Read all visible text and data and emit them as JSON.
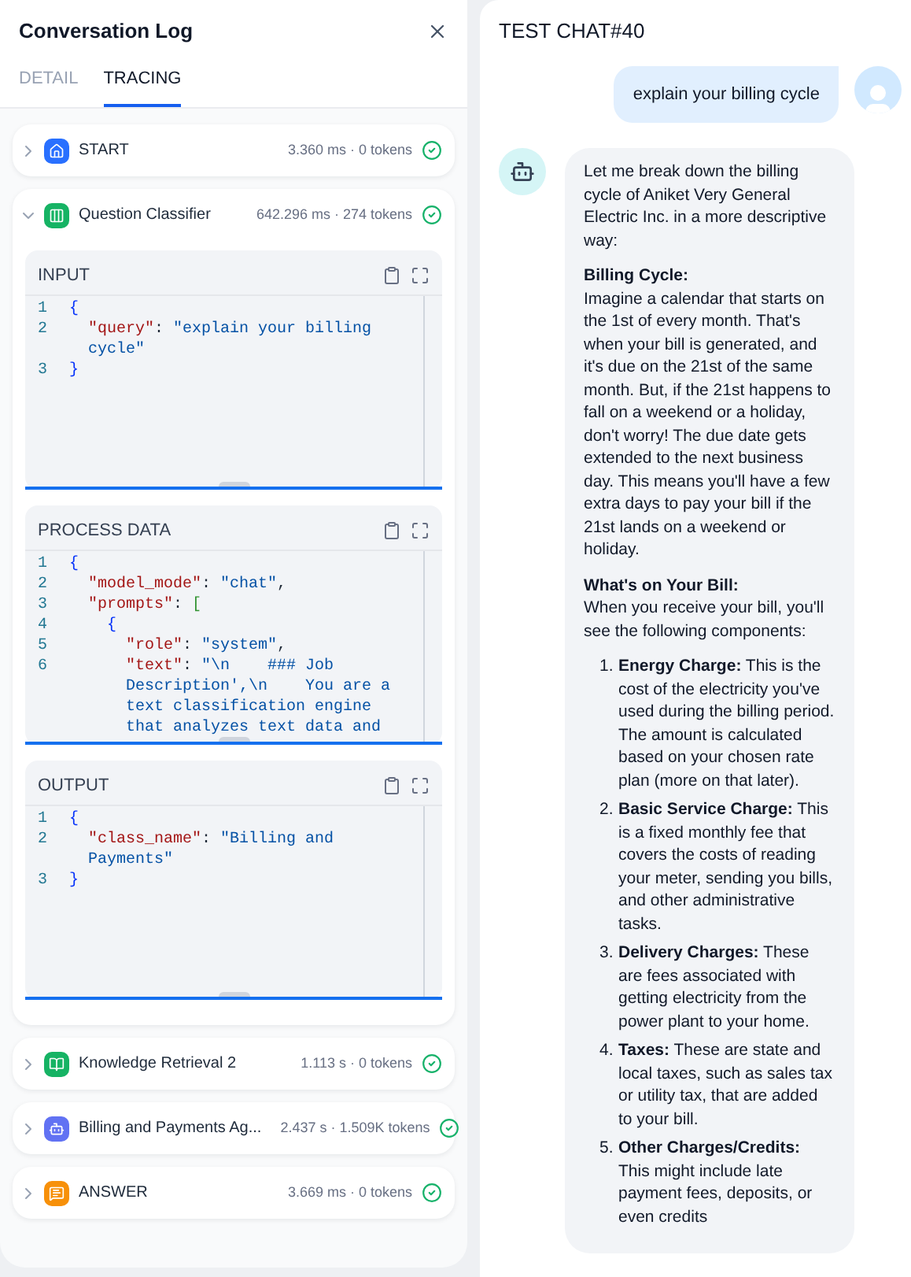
{
  "panel": {
    "title": "Conversation Log",
    "tabs": [
      {
        "label": "DETAIL",
        "selected": false
      },
      {
        "label": "TRACING",
        "selected": true
      }
    ],
    "nodes": [
      {
        "kind": "start",
        "title": "START",
        "color": "#2970ff",
        "stats": "3.360 ms · 0 tokens",
        "expanded": false
      },
      {
        "kind": "question-classifier",
        "title": "Question Classifier",
        "color": "#16b364",
        "stats": "642.296 ms · 274 tokens",
        "expanded": true,
        "sections": [
          {
            "title": "INPUT",
            "lines": [
              {
                "no": "1",
                "parts": [
                  {
                    "kind": "brace",
                    "text": "{"
                  }
                ]
              },
              {
                "no": "2",
                "parts": [
                  {
                    "kind": "key",
                    "text": "  \"query\""
                  },
                  {
                    "kind": "punct",
                    "text": ": "
                  },
                  {
                    "kind": "string",
                    "text": "\"explain your billing"
                  }
                ]
              },
              {
                "parts": [
                  {
                    "kind": "string",
                    "text": "  cycle\""
                  }
                ]
              },
              {
                "no": "3",
                "parts": [
                  {
                    "kind": "brace",
                    "text": "}"
                  }
                ]
              }
            ]
          },
          {
            "title": "PROCESS DATA",
            "lines": [
              {
                "no": "1",
                "parts": [
                  {
                    "kind": "brace",
                    "text": "{"
                  }
                ]
              },
              {
                "no": "2",
                "parts": [
                  {
                    "kind": "key",
                    "text": "  \"model_mode\""
                  },
                  {
                    "kind": "punct",
                    "text": ": "
                  },
                  {
                    "kind": "string",
                    "text": "\"chat\""
                  },
                  {
                    "kind": "punct",
                    "text": ","
                  }
                ]
              },
              {
                "no": "3",
                "parts": [
                  {
                    "kind": "key",
                    "text": "  \"prompts\""
                  },
                  {
                    "kind": "punct",
                    "text": ": "
                  },
                  {
                    "kind": "bracket",
                    "text": "["
                  }
                ]
              },
              {
                "no": "4",
                "parts": [
                  {
                    "kind": "brace",
                    "text": "    {"
                  }
                ]
              },
              {
                "no": "5",
                "parts": [
                  {
                    "kind": "key",
                    "text": "      \"role\""
                  },
                  {
                    "kind": "punct",
                    "text": ": "
                  },
                  {
                    "kind": "string",
                    "text": "\"system\""
                  },
                  {
                    "kind": "punct",
                    "text": ","
                  }
                ]
              },
              {
                "no": "6",
                "parts": [
                  {
                    "kind": "key",
                    "text": "      \"text\""
                  },
                  {
                    "kind": "punct",
                    "text": ": "
                  },
                  {
                    "kind": "string",
                    "text": "\"\\n    ### Job"
                  }
                ]
              },
              {
                "parts": [
                  {
                    "kind": "string",
                    "text": "      Description',\\n    You are a"
                  }
                ]
              },
              {
                "parts": [
                  {
                    "kind": "string",
                    "text": "      text classification engine"
                  }
                ]
              },
              {
                "parts": [
                  {
                    "kind": "string",
                    "text": "      that analyzes text data and"
                  }
                ]
              }
            ]
          },
          {
            "title": "OUTPUT",
            "lines": [
              {
                "no": "1",
                "parts": [
                  {
                    "kind": "brace",
                    "text": "{"
                  }
                ]
              },
              {
                "no": "2",
                "parts": [
                  {
                    "kind": "key",
                    "text": "  \"class_name\""
                  },
                  {
                    "kind": "punct",
                    "text": ": "
                  },
                  {
                    "kind": "string",
                    "text": "\"Billing and"
                  }
                ]
              },
              {
                "parts": [
                  {
                    "kind": "string",
                    "text": "  Payments\""
                  }
                ]
              },
              {
                "no": "3",
                "parts": [
                  {
                    "kind": "brace",
                    "text": "}"
                  }
                ]
              }
            ]
          }
        ]
      },
      {
        "kind": "knowledge-retrieval",
        "title": "Knowledge Retrieval 2",
        "color": "#16b364",
        "stats": "1.113 s · 0 tokens",
        "expanded": false
      },
      {
        "kind": "agent",
        "title": "Billing and Payments Ag...",
        "color": "#6172f3",
        "stats": "2.437 s · 1.509K tokens",
        "expanded": false
      },
      {
        "kind": "answer",
        "title": "ANSWER",
        "color": "#f79009",
        "stats": "3.669 ms · 0 tokens",
        "expanded": false
      }
    ]
  },
  "chat": {
    "title": "TEST CHAT#40",
    "messages": [
      {
        "kind": "user",
        "text": "explain your billing cycle"
      },
      {
        "kind": "bot",
        "blocks": [
          {
            "kind": "paragraph",
            "text": "Let me break down the billing cycle of Aniket Very General Electric Inc. in a more descriptive way:"
          },
          {
            "kind": "section",
            "heading": "Billing Cycle:",
            "text": "Imagine a calendar that starts on the 1st of every month. That's when your bill is generated, and it's due on the 21st of the same month. But, if the 21st happens to fall on a weekend or a holiday, don't worry! The due date gets extended to the next business day. This means you'll have a few extra days to pay your bill if the 21st lands on a weekend or holiday."
          },
          {
            "kind": "section",
            "heading": "What's on Your Bill:",
            "text": "When you receive your bill, you'll see the following components:"
          },
          {
            "kind": "list",
            "items": [
              {
                "marker": "1.",
                "lead": "Energy Charge:",
                "text": "This is the cost of the electricity you've used during the billing period. The amount is calculated based on your chosen rate plan (more on that later)."
              },
              {
                "marker": "2.",
                "lead": "Basic Service Charge:",
                "text": "This is a fixed monthly fee that covers the costs of reading your meter, sending you bills, and other administrative tasks."
              },
              {
                "marker": "3.",
                "lead": "Delivery Charges:",
                "text": "These are fees associated with getting electricity from the power plant to your home."
              },
              {
                "marker": "4.",
                "lead": "Taxes:",
                "text": "These are state and local taxes, such as sales tax or utility tax, that are added to your bill."
              },
              {
                "marker": "5.",
                "lead": "Other Charges/Credits:",
                "text": "This might include late payment fees, deposits, or even credits"
              }
            ]
          }
        ]
      }
    ]
  }
}
